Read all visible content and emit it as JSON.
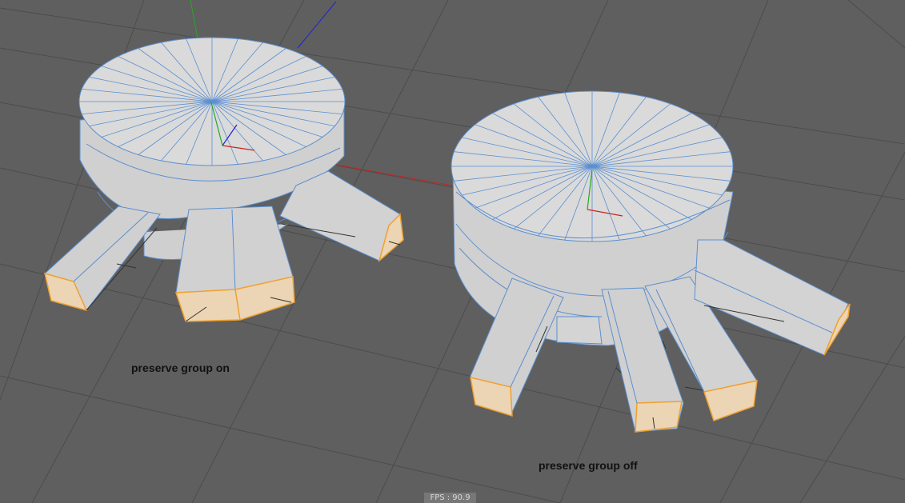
{
  "viewport": {
    "background_color": "#5f5f5f",
    "grid_color": "#4c4c4c",
    "mesh_fill": "#d3d3d3",
    "wire_color": "#5b8fd0",
    "selected_fill": "#ecd5b4",
    "selected_edge": "#f0a030",
    "axis_colors": {
      "x": "#cc2222",
      "y": "#22aa22",
      "z": "#2222cc"
    }
  },
  "labels": {
    "left": "preserve group on",
    "right": "preserve group off"
  },
  "hud": {
    "fps_text": "FPS : 90.9"
  }
}
